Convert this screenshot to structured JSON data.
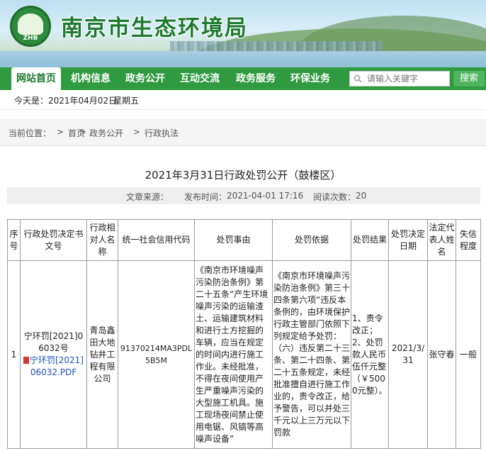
{
  "header": {
    "site_title": "南京市生态环境局",
    "logo_text": "ZHB"
  },
  "nav": {
    "items": [
      {
        "label": "网站首页",
        "active": true
      },
      {
        "label": "机构信息",
        "active": false
      },
      {
        "label": "政务公开",
        "active": false
      },
      {
        "label": "互动交流",
        "active": false
      },
      {
        "label": "政务服务",
        "active": false
      },
      {
        "label": "环保业务",
        "active": false
      }
    ],
    "search_placeholder": "请输入关键字",
    "search_button": "搜索"
  },
  "date_bar": {
    "label": "今天是：",
    "date": "2021年04月02日",
    "weekday": "星期五"
  },
  "breadcrumb": {
    "label": "当前位置：",
    "items": [
      "首页",
      "政务公开",
      "行政执法"
    ],
    "separator": ">"
  },
  "article": {
    "title": "2021年3月31日行政处罚公开（鼓楼区）",
    "source_label": "文章来源：",
    "published_label": "发布时间：",
    "published": "2021-04-01 17:16",
    "views_label": "阅读次数：",
    "views": "20"
  },
  "table": {
    "headers": [
      "序号",
      "行政处罚决定书文号",
      "行政相对人名称",
      "统一社会信用代码",
      "处罚事由",
      "处罚依据",
      "处罚结果",
      "处罚决定日期",
      "法定代表人姓名",
      "失信程度"
    ],
    "rows": [
      {
        "index": "1",
        "doc_no": "宁环罚[2021]06032号",
        "pdf_link": "宁环罚[2021]06032.PDF",
        "party": "青岛鑫田大地钻井工程有限公司",
        "credit_code": "91370214MA3PDL5B5M",
        "reason": "《南京市环境噪声污染防治条例》第二十五条“产生环境噪声污染的运输渣土、运输建筑材料和进行土方挖掘的车辆，应当在规定的时间内进行施工作业。未经批准，不得在夜间使用产生严重噪声污染的大型施工机具。施工现场夜间禁止使用电锯、风镐等高噪声设备”",
        "basis": "《南京市环境噪声污染防治条例》第三十四条第六项“违反本条例的，由环境保护行政主管部门依照下列规定给予处罚：（六）违反第二十三条、第二十四条、第二十五条规定，未经批准擅自进行施工作业的，责令改正，给予警告，可以并处三千元以上三万元以下罚款",
        "result": "1、责令改正；2、处罚款人民币伍仟元整（￥5000元整）。",
        "date": "2021/3/31",
        "legal_rep": "张守春",
        "credit_level": "一般"
      }
    ]
  },
  "colors": {
    "nav_green": "#2f9a3f",
    "title_green": "#1e7a2f",
    "link_blue": "#1a4fbf"
  }
}
